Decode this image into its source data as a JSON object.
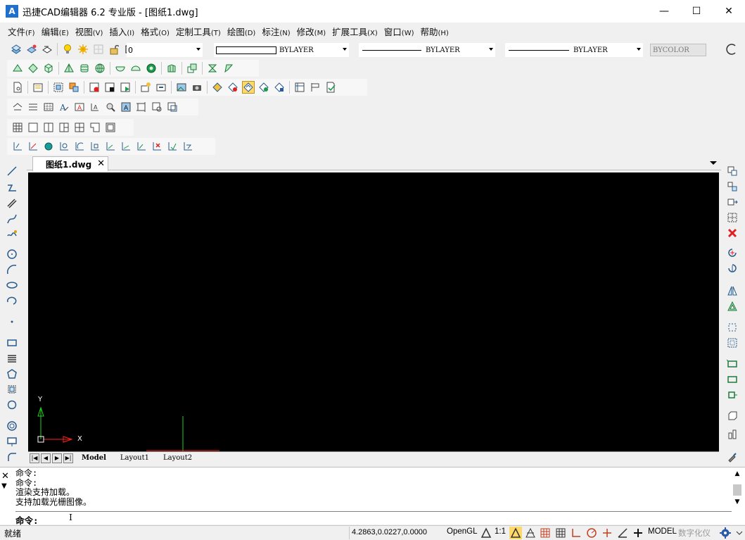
{
  "window": {
    "logo_text": "A",
    "title": "迅捷CAD编辑器 6.2 专业版  - [图纸1.dwg]",
    "minimize": "—",
    "maximize": "☐",
    "close": "✕"
  },
  "menu": [
    {
      "label": "文件",
      "acc": "(F)"
    },
    {
      "label": "编辑",
      "acc": "(E)"
    },
    {
      "label": "视图",
      "acc": "(V)"
    },
    {
      "label": "插入",
      "acc": "(I)"
    },
    {
      "label": "格式",
      "acc": "(O)"
    },
    {
      "label": "定制工具",
      "acc": "(T)"
    },
    {
      "label": "绘图",
      "acc": "(D)"
    },
    {
      "label": "标注",
      "acc": "(N)"
    },
    {
      "label": "修改",
      "acc": "(M)"
    },
    {
      "label": "扩展工具",
      "acc": "(X)"
    },
    {
      "label": "窗口",
      "acc": "(W)"
    },
    {
      "label": "帮助",
      "acc": "(H)"
    }
  ],
  "properties": {
    "layer_value": "0",
    "color_value": "BYLAYER",
    "linetype_value": "BYLAYER",
    "lineweight_value": "BYLAYER",
    "plotstyle_value": "BYCOLOR"
  },
  "document": {
    "tab_label": "图纸1.dwg",
    "tab_close": "✕"
  },
  "ucs": {
    "y_label": "Y",
    "x_label": "X"
  },
  "layout_tabs": [
    "Model",
    "Layout1",
    "Layout2"
  ],
  "command": {
    "history": [
      "命令:",
      "命令:",
      "渲染支持加载。",
      "支持加载光栅图像。"
    ],
    "prompt": "命令:"
  },
  "status": {
    "ready": "就绪",
    "coords": "4.2863,0.0227,0.0000",
    "renderer": "OpenGL",
    "scale": "1:1",
    "space": "MODEL",
    "digitizer": "数字化仪"
  },
  "colors": {
    "canvas_bg": "#000000",
    "accent": "#1f6fd1",
    "ucs_x": "#ff2020",
    "ucs_y": "#20d020"
  }
}
